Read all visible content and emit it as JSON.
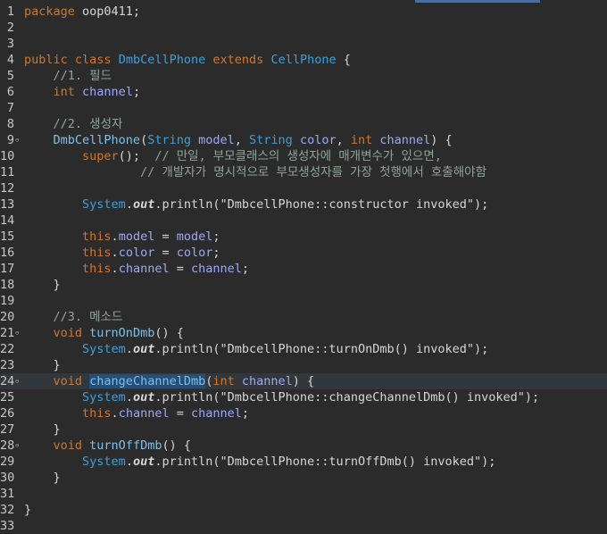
{
  "lines": [
    {
      "n": "1",
      "fold": false,
      "current": false,
      "tokens": [
        {
          "t": "package",
          "c": "kw"
        },
        {
          "t": " oop0411;",
          "c": "plain"
        }
      ]
    },
    {
      "n": "2",
      "fold": false,
      "current": false,
      "tokens": []
    },
    {
      "n": "3",
      "fold": false,
      "current": false,
      "tokens": []
    },
    {
      "n": "4",
      "fold": false,
      "current": false,
      "tokens": [
        {
          "t": "public",
          "c": "kw"
        },
        {
          "t": " ",
          "c": "plain"
        },
        {
          "t": "class",
          "c": "kw"
        },
        {
          "t": " ",
          "c": "plain"
        },
        {
          "t": "DmbCellPhone",
          "c": "ty"
        },
        {
          "t": " ",
          "c": "plain"
        },
        {
          "t": "extends",
          "c": "kw"
        },
        {
          "t": " ",
          "c": "plain"
        },
        {
          "t": "CellPhone",
          "c": "ty"
        },
        {
          "t": " {",
          "c": "plain"
        }
      ]
    },
    {
      "n": "5",
      "fold": false,
      "current": false,
      "tokens": [
        {
          "t": "    //1. 필드",
          "c": "cm"
        }
      ]
    },
    {
      "n": "6",
      "fold": false,
      "current": false,
      "tokens": [
        {
          "t": "    ",
          "c": "plain"
        },
        {
          "t": "int",
          "c": "kw"
        },
        {
          "t": " ",
          "c": "plain"
        },
        {
          "t": "channel",
          "c": "fld"
        },
        {
          "t": ";",
          "c": "plain"
        }
      ]
    },
    {
      "n": "7",
      "fold": false,
      "current": false,
      "tokens": []
    },
    {
      "n": "8",
      "fold": false,
      "current": false,
      "tokens": [
        {
          "t": "    //2. 생성자",
          "c": "cm"
        }
      ]
    },
    {
      "n": "9",
      "fold": true,
      "current": false,
      "tokens": [
        {
          "t": "    ",
          "c": "plain"
        },
        {
          "t": "DmbCellPhone",
          "c": "decl"
        },
        {
          "t": "(",
          "c": "plain"
        },
        {
          "t": "String",
          "c": "ty"
        },
        {
          "t": " ",
          "c": "plain"
        },
        {
          "t": "model",
          "c": "prm"
        },
        {
          "t": ", ",
          "c": "plain"
        },
        {
          "t": "String",
          "c": "ty"
        },
        {
          "t": " ",
          "c": "plain"
        },
        {
          "t": "color",
          "c": "prm"
        },
        {
          "t": ", ",
          "c": "plain"
        },
        {
          "t": "int",
          "c": "kw"
        },
        {
          "t": " ",
          "c": "plain"
        },
        {
          "t": "channel",
          "c": "prm"
        },
        {
          "t": ") {",
          "c": "plain"
        }
      ]
    },
    {
      "n": "10",
      "fold": false,
      "current": false,
      "tokens": [
        {
          "t": "        ",
          "c": "plain"
        },
        {
          "t": "super",
          "c": "kw"
        },
        {
          "t": "();  ",
          "c": "plain"
        },
        {
          "t": "// 만일, 부모클래스의 생성자에 매개변수가 있으면,",
          "c": "cm"
        }
      ]
    },
    {
      "n": "11",
      "fold": false,
      "current": false,
      "tokens": [
        {
          "t": "                ",
          "c": "plain"
        },
        {
          "t": "// 개발자가 명시적으로 부모생성자를 가장 첫행에서 호출해야함",
          "c": "cm"
        }
      ]
    },
    {
      "n": "12",
      "fold": false,
      "current": false,
      "tokens": []
    },
    {
      "n": "13",
      "fold": false,
      "current": false,
      "tokens": [
        {
          "t": "        ",
          "c": "plain"
        },
        {
          "t": "System",
          "c": "cls"
        },
        {
          "t": ".",
          "c": "plain"
        },
        {
          "t": "out",
          "c": "out"
        },
        {
          "t": ".",
          "c": "plain"
        },
        {
          "t": "println",
          "c": "plain"
        },
        {
          "t": "(\"DmbcellPhone::constructor invoked\");",
          "c": "str"
        }
      ]
    },
    {
      "n": "14",
      "fold": false,
      "current": false,
      "tokens": []
    },
    {
      "n": "15",
      "fold": false,
      "current": false,
      "tokens": [
        {
          "t": "        ",
          "c": "plain"
        },
        {
          "t": "this",
          "c": "kw"
        },
        {
          "t": ".",
          "c": "plain"
        },
        {
          "t": "model",
          "c": "fld"
        },
        {
          "t": " = ",
          "c": "plain"
        },
        {
          "t": "model",
          "c": "prm"
        },
        {
          "t": ";",
          "c": "plain"
        }
      ]
    },
    {
      "n": "16",
      "fold": false,
      "current": false,
      "tokens": [
        {
          "t": "        ",
          "c": "plain"
        },
        {
          "t": "this",
          "c": "kw"
        },
        {
          "t": ".",
          "c": "plain"
        },
        {
          "t": "color",
          "c": "fld"
        },
        {
          "t": " = ",
          "c": "plain"
        },
        {
          "t": "color",
          "c": "prm"
        },
        {
          "t": ";",
          "c": "plain"
        }
      ]
    },
    {
      "n": "17",
      "fold": false,
      "current": false,
      "tokens": [
        {
          "t": "        ",
          "c": "plain"
        },
        {
          "t": "this",
          "c": "kw"
        },
        {
          "t": ".",
          "c": "plain"
        },
        {
          "t": "channel",
          "c": "fld"
        },
        {
          "t": " = ",
          "c": "plain"
        },
        {
          "t": "channel",
          "c": "prm"
        },
        {
          "t": ";",
          "c": "plain"
        }
      ]
    },
    {
      "n": "18",
      "fold": false,
      "current": false,
      "tokens": [
        {
          "t": "    }",
          "c": "plain"
        }
      ]
    },
    {
      "n": "19",
      "fold": false,
      "current": false,
      "tokens": []
    },
    {
      "n": "20",
      "fold": false,
      "current": false,
      "tokens": [
        {
          "t": "    //3. 메소드",
          "c": "cm"
        }
      ]
    },
    {
      "n": "21",
      "fold": true,
      "current": false,
      "tokens": [
        {
          "t": "    ",
          "c": "plain"
        },
        {
          "t": "void",
          "c": "kw"
        },
        {
          "t": " ",
          "c": "plain"
        },
        {
          "t": "turnOnDmb",
          "c": "decl"
        },
        {
          "t": "() {",
          "c": "plain"
        }
      ]
    },
    {
      "n": "22",
      "fold": false,
      "current": false,
      "tokens": [
        {
          "t": "        ",
          "c": "plain"
        },
        {
          "t": "System",
          "c": "cls"
        },
        {
          "t": ".",
          "c": "plain"
        },
        {
          "t": "out",
          "c": "out"
        },
        {
          "t": ".",
          "c": "plain"
        },
        {
          "t": "println",
          "c": "plain"
        },
        {
          "t": "(\"DmbcellPhone::turnOnDmb() invoked\");",
          "c": "str"
        }
      ]
    },
    {
      "n": "23",
      "fold": false,
      "current": false,
      "tokens": [
        {
          "t": "    }",
          "c": "plain"
        }
      ]
    },
    {
      "n": "24",
      "fold": true,
      "current": true,
      "tokens": [
        {
          "t": "    ",
          "c": "plain"
        },
        {
          "t": "void",
          "c": "kw"
        },
        {
          "t": " ",
          "c": "plain"
        },
        {
          "t": "changeChannelDmb",
          "c": "decl hl"
        },
        {
          "t": "(",
          "c": "plain"
        },
        {
          "t": "int",
          "c": "kw"
        },
        {
          "t": " ",
          "c": "plain"
        },
        {
          "t": "channel",
          "c": "prm"
        },
        {
          "t": ") {",
          "c": "plain"
        }
      ]
    },
    {
      "n": "25",
      "fold": false,
      "current": false,
      "tokens": [
        {
          "t": "        ",
          "c": "plain"
        },
        {
          "t": "System",
          "c": "cls"
        },
        {
          "t": ".",
          "c": "plain"
        },
        {
          "t": "out",
          "c": "out"
        },
        {
          "t": ".",
          "c": "plain"
        },
        {
          "t": "println",
          "c": "plain"
        },
        {
          "t": "(\"DmbcellPhone::changeChannelDmb() invoked\");",
          "c": "str"
        }
      ]
    },
    {
      "n": "26",
      "fold": false,
      "current": false,
      "tokens": [
        {
          "t": "        ",
          "c": "plain"
        },
        {
          "t": "this",
          "c": "kw"
        },
        {
          "t": ".",
          "c": "plain"
        },
        {
          "t": "channel",
          "c": "fld"
        },
        {
          "t": " = ",
          "c": "plain"
        },
        {
          "t": "channel",
          "c": "prm"
        },
        {
          "t": ";",
          "c": "plain"
        }
      ]
    },
    {
      "n": "27",
      "fold": false,
      "current": false,
      "tokens": [
        {
          "t": "    }",
          "c": "plain"
        }
      ]
    },
    {
      "n": "28",
      "fold": true,
      "current": false,
      "tokens": [
        {
          "t": "    ",
          "c": "plain"
        },
        {
          "t": "void",
          "c": "kw"
        },
        {
          "t": " ",
          "c": "plain"
        },
        {
          "t": "turnOffDmb",
          "c": "decl"
        },
        {
          "t": "() {",
          "c": "plain"
        }
      ]
    },
    {
      "n": "29",
      "fold": false,
      "current": false,
      "tokens": [
        {
          "t": "        ",
          "c": "plain"
        },
        {
          "t": "System",
          "c": "cls"
        },
        {
          "t": ".",
          "c": "plain"
        },
        {
          "t": "out",
          "c": "out"
        },
        {
          "t": ".",
          "c": "plain"
        },
        {
          "t": "println",
          "c": "plain"
        },
        {
          "t": "(\"DmbcellPhone::turnOffDmb() invoked\");",
          "c": "str"
        }
      ]
    },
    {
      "n": "30",
      "fold": false,
      "current": false,
      "tokens": [
        {
          "t": "    }",
          "c": "plain"
        }
      ]
    },
    {
      "n": "31",
      "fold": false,
      "current": false,
      "tokens": []
    },
    {
      "n": "32",
      "fold": false,
      "current": false,
      "tokens": [
        {
          "t": "}",
          "c": "plain"
        }
      ]
    },
    {
      "n": "33",
      "fold": false,
      "current": false,
      "tokens": []
    }
  ],
  "fold_icon": "collapse-icon",
  "colors": {
    "background": "#2b2b2b",
    "keyword": "#cc7832",
    "type": "#3f9fd8",
    "comment": "#8fa59a",
    "field": "#9fa9f0",
    "selection": "#264f78",
    "current_line": "#32373b"
  }
}
